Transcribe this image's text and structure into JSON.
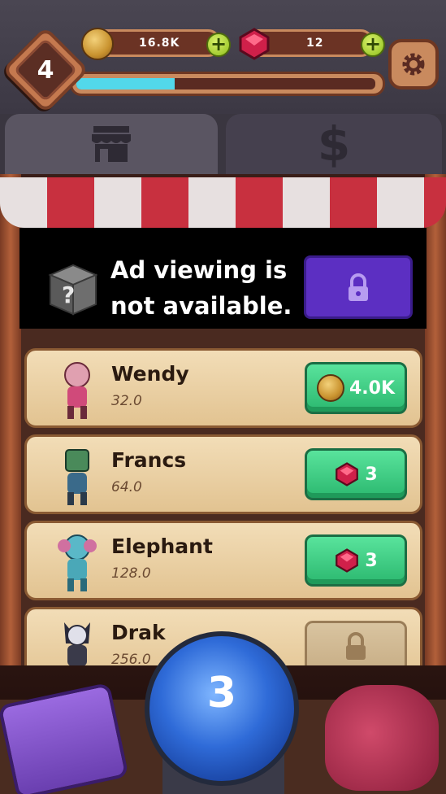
{
  "hud": {
    "level": "4",
    "coins": "16.8K",
    "gems": "12",
    "xp_progress": 0.33
  },
  "tabs": [
    {
      "name": "shop",
      "icon": "shop-icon"
    },
    {
      "name": "money",
      "icon": "dollar-icon",
      "glyph": "$"
    }
  ],
  "ad_banner": {
    "text": "Ad viewing is not available.",
    "icon": "mystery-box-icon",
    "button_icon": "lock-icon"
  },
  "items": [
    {
      "name": "Wendy",
      "price_level": "32.0",
      "cost": "4.0K",
      "currency": "coin"
    },
    {
      "name": "Francs",
      "price_level": "64.0",
      "cost": "3",
      "currency": "gem"
    },
    {
      "name": "Elephant",
      "price_level": "128.0",
      "cost": "3",
      "currency": "gem"
    },
    {
      "name": "Drak",
      "price_level": "256.0",
      "cost": "",
      "currency": "locked"
    }
  ],
  "orb": {
    "count": "3"
  },
  "colors": {
    "accent_green": "#2bb86f",
    "ad_button": "#5c2fc2",
    "xp_fill": "#52d8ea",
    "awning_red": "#c8303f"
  }
}
